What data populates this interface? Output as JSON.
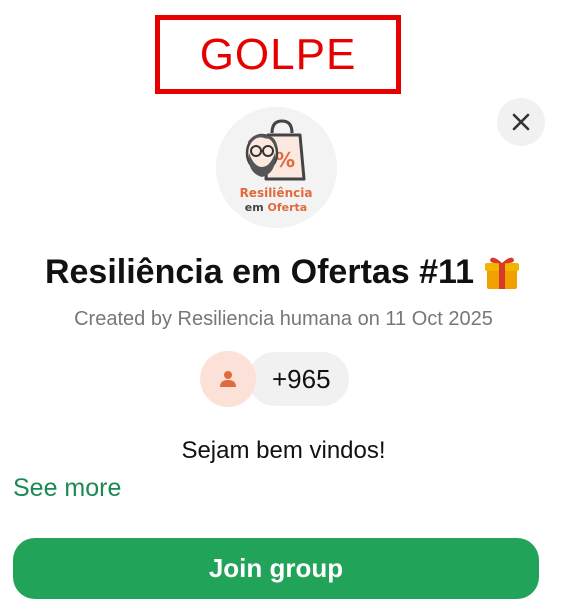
{
  "stamp": {
    "text": "GOLPE",
    "color": "#e60000"
  },
  "close_button": {
    "icon": "close-icon"
  },
  "group": {
    "avatar_logo_text": "Resiliência em Oferta",
    "title": "Resiliência em Ofertas #11",
    "title_emoji": "gift-icon",
    "created_by": "Created by Resiliencia humana on 11 Oct 2025",
    "member_count": "+965",
    "description": "Sejam bem vindos!",
    "see_more": "See more"
  },
  "actions": {
    "join_label": "Join group"
  },
  "colors": {
    "accent_green": "#22a35a",
    "link_green": "#1b8a52",
    "member_avatar_bg": "#fbe1d8",
    "member_icon": "#e06a3c"
  }
}
